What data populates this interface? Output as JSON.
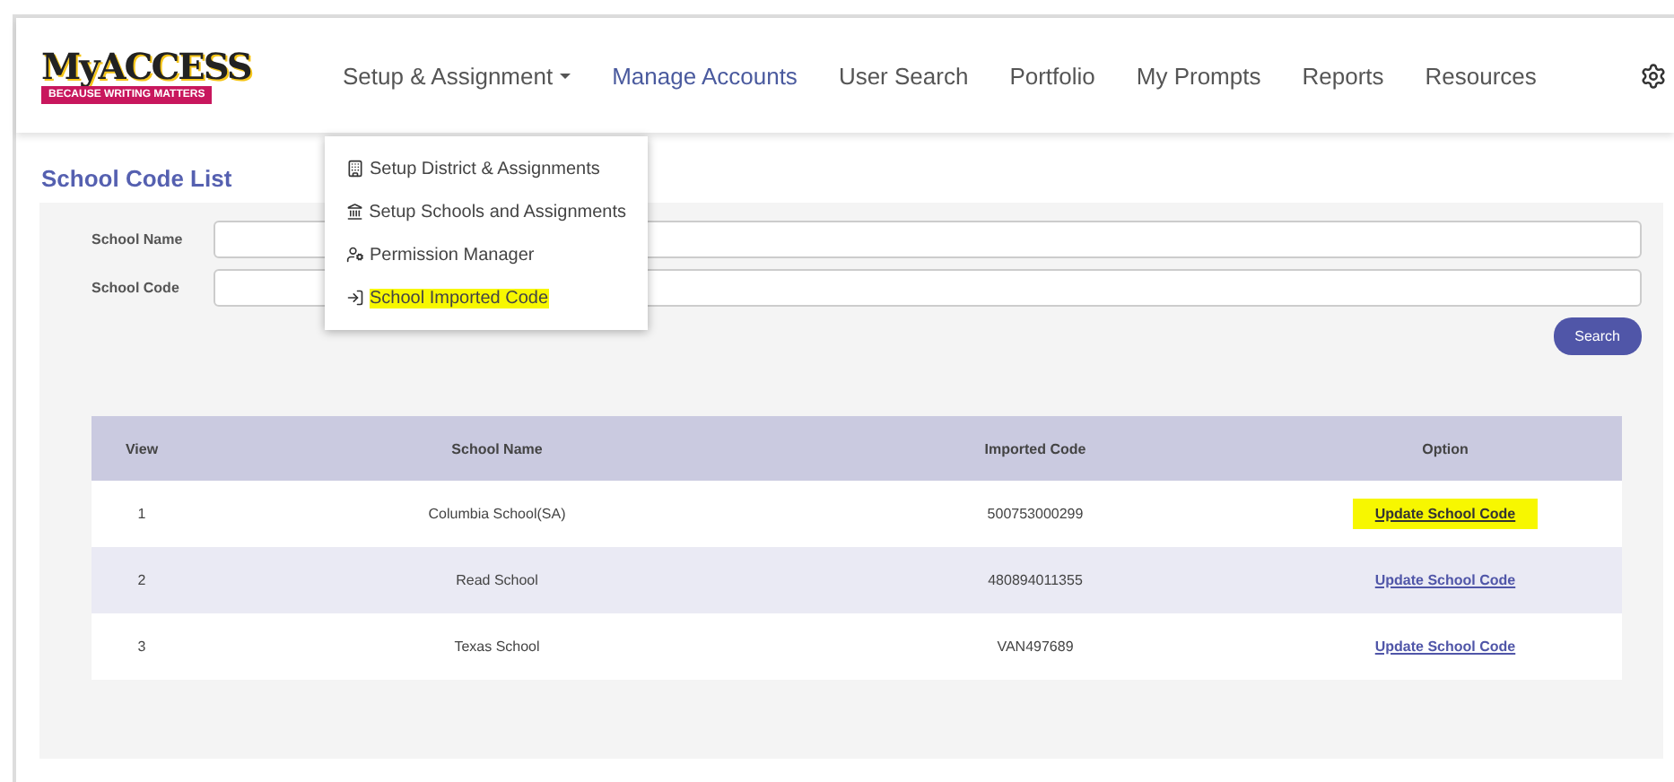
{
  "logo": {
    "name": "MyACCESS",
    "tagline": "BECAUSE WRITING MATTERS"
  },
  "nav": [
    {
      "label": "Setup & Assignment",
      "selected": false,
      "dropdown": true
    },
    {
      "label": "Manage Accounts",
      "selected": true,
      "dropdown": false
    },
    {
      "label": "User Search",
      "selected": false,
      "dropdown": false
    },
    {
      "label": "Portfolio",
      "selected": false,
      "dropdown": false
    },
    {
      "label": "My Prompts",
      "selected": false,
      "dropdown": false
    },
    {
      "label": "Reports",
      "selected": false,
      "dropdown": false
    },
    {
      "label": "Resources",
      "selected": false,
      "dropdown": false
    }
  ],
  "menu": [
    {
      "label": "Setup District & Assignments",
      "kind": "district",
      "highlighted": false
    },
    {
      "label": "Setup Schools and Assignments",
      "kind": "school",
      "highlighted": false
    },
    {
      "label": "Permission Manager",
      "kind": "permission",
      "highlighted": false
    },
    {
      "label": "School Imported Code",
      "kind": "import",
      "highlighted": true
    }
  ],
  "page_title": "School Code List",
  "filters": [
    {
      "label": "School Name"
    },
    {
      "label": "School Code"
    }
  ],
  "search_button": "Search",
  "table": {
    "columns": [
      "View",
      "School Name",
      "Imported Code",
      "Option"
    ],
    "rows": [
      {
        "cells": [
          "1",
          "Columbia School(SA)",
          "500753000299"
        ],
        "action": "Update School Code",
        "highlighted": true
      },
      {
        "cells": [
          "2",
          "Read School",
          "480894011355"
        ],
        "action": "Update School Code",
        "highlighted": false
      },
      {
        "cells": [
          "3",
          "Texas School",
          "VAN497689"
        ],
        "action": "Update School Code",
        "highlighted": false
      }
    ]
  }
}
